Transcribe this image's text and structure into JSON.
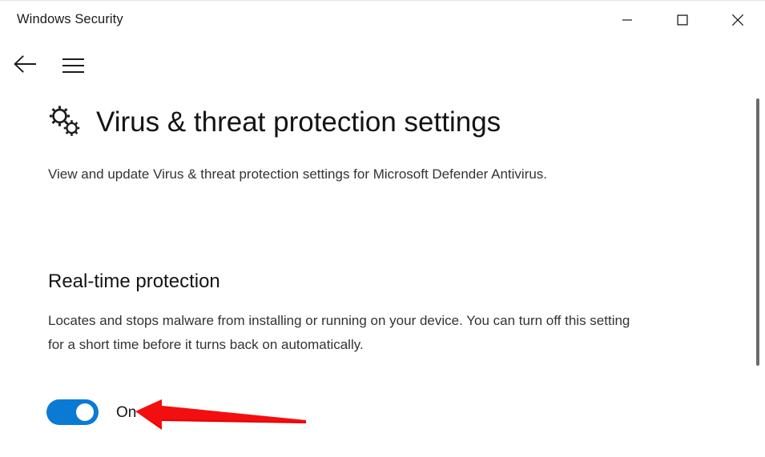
{
  "window": {
    "title": "Windows Security",
    "caption": {
      "minimize_label": "Minimize",
      "maximize_label": "Maximize",
      "close_label": "Close"
    }
  },
  "navbar": {
    "back_label": "Back",
    "menu_label": "Menu"
  },
  "page": {
    "icon": "gears-icon",
    "title": "Virus & threat protection settings",
    "description": "View and update Virus & threat protection settings for Microsoft Defender Antivirus."
  },
  "sections": [
    {
      "title": "Real-time protection",
      "description": "Locates and stops malware from installing or running on your device. You can turn off this setting for a short time before it turns back on automatically.",
      "toggle": {
        "state_label": "On",
        "checked": true,
        "on_color": "#0b7ad4",
        "knob_color": "#ffffff"
      }
    }
  ],
  "annotation": {
    "type": "arrow",
    "direction": "left",
    "color": "#e00000",
    "points_to": "real-time-protection-toggle"
  },
  "scrollbar": {
    "orientation": "vertical",
    "thumb_color": "#6b6b6b"
  },
  "colors": {
    "background": "#ffffff",
    "text_primary": "#141414",
    "text_secondary": "#333333",
    "accent": "#0b7ad4",
    "annotation_red": "#e00000"
  }
}
